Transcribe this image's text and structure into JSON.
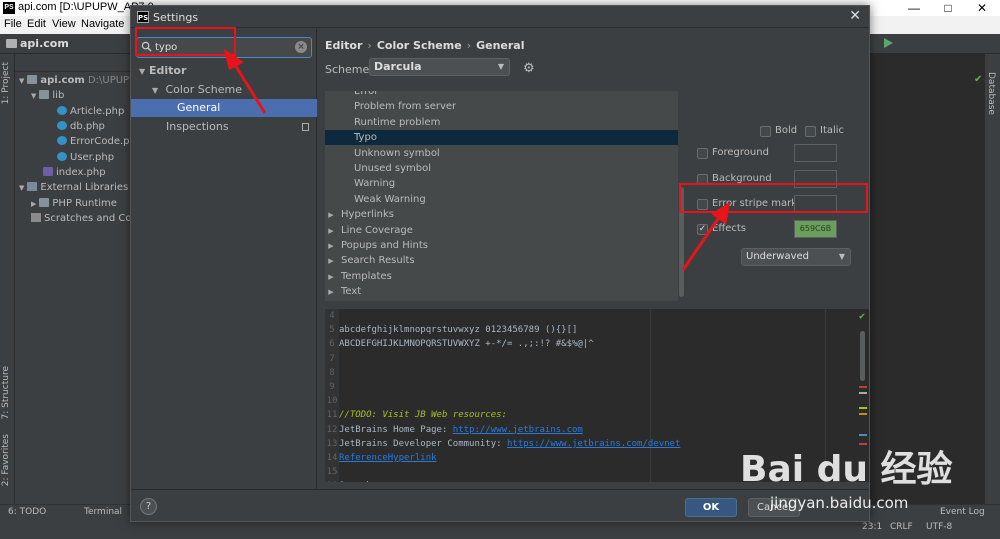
{
  "ide": {
    "window_title": "api.com [D:\\UPUPW_AP7.0",
    "logo_text": "PS",
    "menu": [
      "File",
      "Edit",
      "View",
      "Navigate"
    ],
    "project_name": "api.com",
    "side_tabs": [
      "1: Project",
      "7: Structure",
      "2: Favorites"
    ],
    "right_tab": "Database",
    "tree": [
      {
        "label": "api.com",
        "suffix": "D:\\UPUPW"
      },
      {
        "label": "lib"
      },
      {
        "label": "Article.php"
      },
      {
        "label": "db.php"
      },
      {
        "label": "ErrorCode.p"
      },
      {
        "label": "User.php"
      },
      {
        "label": "index.php"
      },
      {
        "label": "External Libraries"
      },
      {
        "label": "PHP Runtime"
      },
      {
        "label": "Scratches and Con"
      }
    ],
    "status": {
      "todo": "6: TODO",
      "terminal": "Terminal",
      "event_log": "Event Log",
      "position": "23:1",
      "line_sep": "CRLF",
      "encoding": "UTF-8"
    }
  },
  "dialog": {
    "title": "Settings",
    "logo_text": "PS",
    "search": {
      "value": "typo",
      "placeholder": ""
    },
    "tree": {
      "editor": "Editor",
      "color_scheme": "Color Scheme",
      "general": "General",
      "inspections": "Inspections"
    },
    "breadcrumb": [
      "Editor",
      "Color Scheme",
      "General"
    ],
    "scheme_label": "Scheme:",
    "scheme_value": "Darcula",
    "attributes": [
      {
        "label": "Error",
        "expandable": false
      },
      {
        "label": "Problem from server",
        "expandable": false
      },
      {
        "label": "Runtime problem",
        "expandable": false
      },
      {
        "label": "Typo",
        "expandable": false,
        "selected": true
      },
      {
        "label": "Unknown symbol",
        "expandable": false
      },
      {
        "label": "Unused symbol",
        "expandable": false
      },
      {
        "label": "Warning",
        "expandable": false
      },
      {
        "label": "Weak Warning",
        "expandable": false
      },
      {
        "label": "Hyperlinks",
        "expandable": true
      },
      {
        "label": "Line Coverage",
        "expandable": true
      },
      {
        "label": "Popups and Hints",
        "expandable": true
      },
      {
        "label": "Search Results",
        "expandable": true
      },
      {
        "label": "Templates",
        "expandable": true
      },
      {
        "label": "Text",
        "expandable": true
      }
    ],
    "props": {
      "bold": "Bold",
      "italic": "Italic",
      "foreground": "Foreground",
      "background": "Background",
      "error_stripe": "Error stripe mark",
      "effects": "Effects",
      "effects_checked": true,
      "effects_color": "659C6B",
      "effects_color_hex": "#6a9f5c",
      "effect_type": "Underwaved"
    },
    "preview": [
      {
        "n": "4",
        "type": "code",
        "text": ""
      },
      {
        "n": "5",
        "type": "code",
        "text": "abcdefghijklmnopqrstuvwxyz 0123456789 (){}[]"
      },
      {
        "n": "6",
        "type": "code",
        "text": "ABCDEFGHIJKLMNOPQRSTUVWXYZ +-*/= .,;:!? #&$%@|^"
      },
      {
        "n": "7",
        "type": "code",
        "text": ""
      },
      {
        "n": "8",
        "type": "code",
        "text": ""
      },
      {
        "n": "9",
        "type": "code",
        "text": ""
      },
      {
        "n": "10",
        "type": "code",
        "text": ""
      },
      {
        "n": "11",
        "type": "todo",
        "text": "//TODO: Visit JB Web resources:"
      },
      {
        "n": "12",
        "type": "mixed",
        "text": "JetBrains Home Page: ",
        "link": "http://www.jetbrains.com"
      },
      {
        "n": "13",
        "type": "mixed",
        "text": "JetBrains Developer Community: ",
        "link": "https://www.jetbrains.com/devnet"
      },
      {
        "n": "14",
        "type": "link",
        "text": "",
        "link": "ReferenceHyperlink"
      },
      {
        "n": "15",
        "type": "code",
        "text": ""
      },
      {
        "n": "16",
        "type": "code",
        "text": "Search:"
      }
    ],
    "buttons": {
      "help": "?",
      "ok": "OK",
      "cancel": "Cancel"
    }
  },
  "watermark": {
    "brand": "Bai du 经验",
    "url": "jingyan.baidu.com"
  },
  "colors": {
    "annotation": "#e8141c",
    "selection": "#4b6eaf",
    "accent_button": "#365880"
  }
}
